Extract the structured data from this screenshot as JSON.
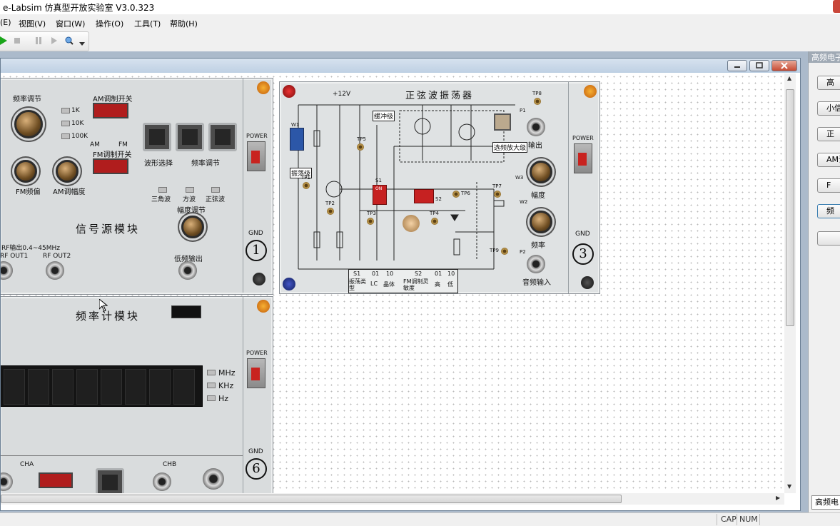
{
  "window": {
    "title": "e-Labsim 仿真型开放实验室 V3.0.323"
  },
  "menu": [
    {
      "label": "(E)"
    },
    {
      "label": "视图(V)"
    },
    {
      "label": "窗口(W)"
    },
    {
      "label": "操作(O)"
    },
    {
      "label": "工具(T)"
    },
    {
      "label": "帮助(H)"
    }
  ],
  "module1": {
    "freq_adj": "频率调节",
    "am_switch": "AM调制开关",
    "fm_switch": "FM调制开关",
    "range_1k": "1K",
    "range_10k": "10K",
    "range_100k": "100K",
    "am": "AM",
    "fm": "FM",
    "wave_select": "波形选择",
    "freq_adjust2": "频率调节",
    "fm_offset": "FM频偏",
    "am_depth": "AM调幅度",
    "tri": "三角波",
    "square": "方波",
    "sine": "正弦波",
    "amp_adj": "幅度调节",
    "title": "信号源模块",
    "rf_range": "RF输出0.4~45MHz",
    "rf_out1": "RF OUT1",
    "rf_out2": "RF OUT2",
    "lf_out": "低频输出",
    "power": "POWER",
    "gnd": "GND",
    "number": "1"
  },
  "module3": {
    "title": "正弦波振荡器",
    "vcc": "+12V",
    "buffer": "缓冲级",
    "osc": "振荡级",
    "sel_amp": "选频放大级",
    "out": "输出",
    "amp": "幅度",
    "freq": "频率",
    "audio_in": "音频输入",
    "power": "POWER",
    "gnd": "GND",
    "number": "3",
    "table": {
      "h1": "S1",
      "h2": "01",
      "h3": "10",
      "h4": "S2",
      "h5": "01",
      "h6": "10",
      "r1": "振荡类型",
      "r2": "LC",
      "r3": "晶体",
      "r4": "FM调制灵敏度",
      "r5": "高",
      "r6": "低"
    },
    "tp": [
      "TP1",
      "TP2",
      "TP3",
      "TP4",
      "TP5",
      "TP6",
      "TP7",
      "TP8",
      "TP9"
    ],
    "w": [
      "W1",
      "W2",
      "W3"
    ],
    "p": [
      "P1",
      "P2"
    ],
    "s": [
      "S1",
      "S2"
    ],
    "on": "ON"
  },
  "module6": {
    "title": "频率计模块",
    "mhz": "MHz",
    "khz": "KHz",
    "hz": "Hz",
    "cha": "CHA",
    "chb": "CHB",
    "power": "POWER",
    "gnd": "GND",
    "number": "6"
  },
  "right_pane": {
    "header": "高频电子",
    "buttons": [
      "高",
      "小信",
      "正",
      "AM调",
      "F",
      "频",
      ""
    ],
    "tab": "高频电"
  },
  "status": {
    "cap": "CAP",
    "num": "NUM"
  },
  "colors": {
    "mdi_bg": "#abbacb",
    "title_gradient_top": "#d7e2ef",
    "accent_red": "#b01d1d"
  }
}
